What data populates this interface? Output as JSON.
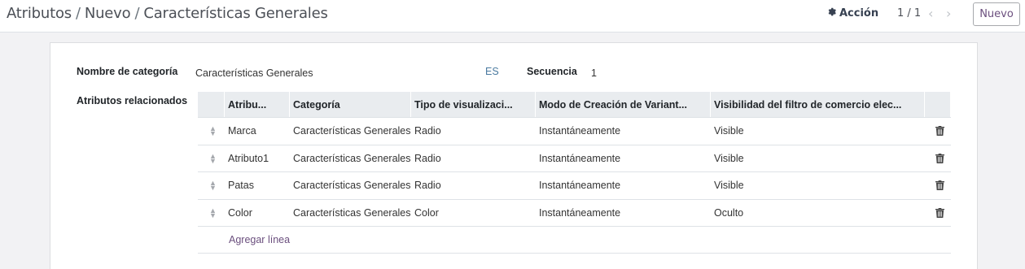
{
  "breadcrumb": {
    "items": [
      "Atributos",
      "Nuevo"
    ],
    "current": "Características Generales",
    "separator": "/"
  },
  "toolbar": {
    "action_label": "Acción",
    "pager_value": "1 / 1",
    "new_label": "Nuevo"
  },
  "form": {
    "category_name_label": "Nombre de categoría",
    "category_name_value": "Características Generales",
    "lang_badge": "ES",
    "sequence_label": "Secuencia",
    "sequence_value": "1",
    "related_attributes_label": "Atributos relacionados"
  },
  "table": {
    "headers": [
      "Atribu...",
      "Categoría",
      "Tipo de visualizaci...",
      "Modo de Creación de Variant...",
      "Visibilidad del filtro de comercio elec..."
    ],
    "rows": [
      [
        "Marca",
        "Características Generales",
        "Radio",
        "Instantáneamente",
        "Visible"
      ],
      [
        "Atributo1",
        "Características Generales",
        "Radio",
        "Instantáneamente",
        "Visible"
      ],
      [
        "Patas",
        "Características Generales",
        "Radio",
        "Instantáneamente",
        "Visible"
      ],
      [
        "Color",
        "Características Generales",
        "Color",
        "Instantáneamente",
        "Oculto"
      ]
    ],
    "add_line_label": "Agregar línea"
  },
  "colors": {
    "accent": "#6b4f7e",
    "header_bg": "#e9ecef"
  }
}
